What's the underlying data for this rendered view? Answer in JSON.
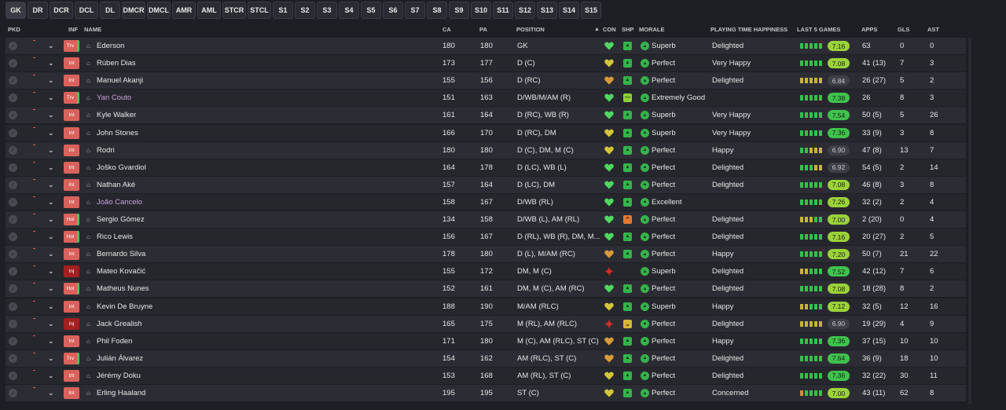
{
  "tabs": [
    "GK",
    "DR",
    "DCR",
    "DCL",
    "DL",
    "DMCR",
    "DMCL",
    "AMR",
    "AML",
    "STCR",
    "STCL",
    "S1",
    "S2",
    "S3",
    "S4",
    "S5",
    "S6",
    "S7",
    "S8",
    "S9",
    "S10",
    "S11",
    "S12",
    "S13",
    "S14",
    "S15"
  ],
  "columns": {
    "pkd": "PKD",
    "inf": "INF",
    "name": "NAME",
    "ca": "CA",
    "pa": "PA",
    "position": "POSITION",
    "con": "CON",
    "shp": "SHP",
    "morale": "MORALE",
    "happiness": "PLAYING TIME HAPPINESS",
    "last5": "LAST 5 GAMES",
    "apps": "APPS",
    "gls": "GLS",
    "ast": "AST"
  },
  "colors": {
    "green": "#35c24a",
    "yellow": "#d6c73a",
    "orange": "#e08a30",
    "red": "#d84a3a",
    "bar_green": "#35c24a",
    "bar_yellow": "#c9b43a",
    "bar_orange": "#d88a35",
    "rating_green": "#3fc24c",
    "rating_lime": "#9bd23a",
    "rating_dim": "#3e4047",
    "con_green": "#4fd85f",
    "con_yellow": "#d4c63a",
    "con_orange": "#d99a3a"
  },
  "players": [
    {
      "inf": "Trv",
      "name": "Ederson",
      "loan": false,
      "ca": "180",
      "pa": "180",
      "position": "GK",
      "con": "green",
      "shp": "green",
      "morale": "Superb",
      "happiness": "Delighted",
      "bars": [
        "g",
        "g",
        "g",
        "g",
        "g"
      ],
      "rating": "7.16",
      "rating_style": "green",
      "apps": "63",
      "gls": "0",
      "ast": "0"
    },
    {
      "inf": "Int",
      "name": "Rúben Dias",
      "loan": false,
      "ca": "173",
      "pa": "177",
      "position": "D (C)",
      "con": "yellow",
      "shp": "green",
      "morale": "Perfect",
      "happiness": "Very Happy",
      "bars": [
        "g",
        "g",
        "g",
        "g",
        "g"
      ],
      "rating": "7.08",
      "rating_style": "green",
      "apps": "41 (13)",
      "gls": "7",
      "ast": "3"
    },
    {
      "inf": "Int",
      "name": "Manuel Akanji",
      "loan": false,
      "ca": "155",
      "pa": "156",
      "position": "D (RC)",
      "con": "orange",
      "shp": "green",
      "morale": "Perfect",
      "happiness": "Delighted",
      "bars": [
        "y",
        "y",
        "y",
        "y",
        "y"
      ],
      "rating": "6.84",
      "rating_style": "dim",
      "apps": "26 (27)",
      "gls": "5",
      "ast": "2"
    },
    {
      "inf": "Trv",
      "name": "Yan Couto",
      "loan": true,
      "ca": "151",
      "pa": "163",
      "position": "D/WB/M/AM (R)",
      "con": "green",
      "shp": "lime",
      "morale": "Extremely Good",
      "happiness": "",
      "bars": [
        "g",
        "g",
        "g",
        "g",
        "g"
      ],
      "rating": "7.38",
      "rating_style": "green",
      "apps": "26",
      "gls": "8",
      "ast": "3"
    },
    {
      "inf": "Int",
      "name": "Kyle Walker",
      "loan": false,
      "ca": "161",
      "pa": "164",
      "position": "D (RC), WB (R)",
      "con": "green",
      "shp": "green",
      "morale": "Superb",
      "happiness": "Very Happy",
      "bars": [
        "g",
        "g",
        "g",
        "g",
        "g"
      ],
      "rating": "7.54",
      "rating_style": "green",
      "apps": "50 (5)",
      "gls": "5",
      "ast": "26"
    },
    {
      "inf": "Int",
      "name": "John Stones",
      "loan": false,
      "ca": "166",
      "pa": "170",
      "position": "D (RC), DM",
      "con": "yellow",
      "shp": "green",
      "morale": "Superb",
      "happiness": "Very Happy",
      "bars": [
        "g",
        "g",
        "g",
        "g",
        "g"
      ],
      "rating": "7.36",
      "rating_style": "green",
      "apps": "33 (9)",
      "gls": "3",
      "ast": "8"
    },
    {
      "inf": "Int",
      "name": "Rodri",
      "loan": false,
      "ca": "180",
      "pa": "180",
      "position": "D (C), DM, M (C)",
      "con": "yellow",
      "shp": "green",
      "morale": "Perfect",
      "happiness": "Happy",
      "bars": [
        "g",
        "g",
        "y",
        "y",
        "y"
      ],
      "rating": "6.90",
      "rating_style": "dim",
      "apps": "47 (8)",
      "gls": "13",
      "ast": "7"
    },
    {
      "inf": "Int",
      "name": "Joško Gvardiol",
      "loan": false,
      "ca": "164",
      "pa": "178",
      "position": "D (LC), WB (L)",
      "con": "green",
      "shp": "green",
      "morale": "Perfect",
      "happiness": "Delighted",
      "bars": [
        "g",
        "g",
        "g",
        "y",
        "y"
      ],
      "rating": "6.92",
      "rating_style": "dim",
      "apps": "54 (5)",
      "gls": "2",
      "ast": "14"
    },
    {
      "inf": "Int",
      "name": "Nathan Aké",
      "loan": false,
      "ca": "157",
      "pa": "164",
      "position": "D (LC), DM",
      "con": "green",
      "shp": "green",
      "morale": "Perfect",
      "happiness": "Delighted",
      "bars": [
        "g",
        "g",
        "g",
        "g",
        "g"
      ],
      "rating": "7.08",
      "rating_style": "green",
      "apps": "46 (8)",
      "gls": "3",
      "ast": "8"
    },
    {
      "inf": "Int",
      "name": "João Cancelo",
      "loan": true,
      "ca": "158",
      "pa": "167",
      "position": "D/WB (RL)",
      "con": "green",
      "shp": "green",
      "morale": "Excellent",
      "happiness": "",
      "bars": [
        "g",
        "g",
        "g",
        "g",
        "g"
      ],
      "rating": "7.26",
      "rating_style": "green",
      "apps": "32 (2)",
      "gls": "2",
      "ast": "4"
    },
    {
      "inf": "Hol",
      "name": "Sergio Gómez",
      "loan": false,
      "ca": "134",
      "pa": "158",
      "position": "D/WB (L), AM (RL)",
      "con": "green",
      "shp": "orange",
      "morale": "Perfect",
      "happiness": "Delighted",
      "bars": [
        "y",
        "y",
        "y",
        "g",
        "g"
      ],
      "rating": "7.00",
      "rating_style": "green",
      "apps": "2 (20)",
      "gls": "0",
      "ast": "4"
    },
    {
      "inf": "Hol",
      "name": "Rico Lewis",
      "loan": false,
      "ca": "156",
      "pa": "167",
      "position": "D (RL), WB (R), DM, M...",
      "con": "green",
      "shp": "green",
      "morale": "Perfect",
      "happiness": "Delighted",
      "bars": [
        "g",
        "g",
        "g",
        "g",
        "g"
      ],
      "rating": "7.16",
      "rating_style": "green",
      "apps": "20 (27)",
      "gls": "2",
      "ast": "5"
    },
    {
      "inf": "Int",
      "name": "Bernardo Silva",
      "loan": false,
      "ca": "178",
      "pa": "180",
      "position": "D (L), M/AM (RC)",
      "con": "orange",
      "shp": "green",
      "morale": "Perfect",
      "happiness": "Happy",
      "bars": [
        "g",
        "g",
        "g",
        "g",
        "g"
      ],
      "rating": "7.20",
      "rating_style": "green",
      "apps": "50 (7)",
      "gls": "21",
      "ast": "22"
    },
    {
      "inf": "Inj",
      "name": "Mateo Kovačić",
      "loan": false,
      "ca": "155",
      "pa": "172",
      "position": "DM, M (C)",
      "con": "injury",
      "shp": "none",
      "morale": "Superb",
      "happiness": "Delighted",
      "bars": [
        "y",
        "y",
        "g",
        "g",
        "g"
      ],
      "rating": "7.52",
      "rating_style": "green",
      "apps": "42 (12)",
      "gls": "7",
      "ast": "6"
    },
    {
      "inf": "Hol",
      "name": "Matheus Nunes",
      "loan": false,
      "ca": "152",
      "pa": "161",
      "position": "DM, M (C), AM (RC)",
      "con": "green",
      "shp": "green",
      "morale": "Perfect",
      "happiness": "Delighted",
      "bars": [
        "g",
        "g",
        "g",
        "g",
        "g"
      ],
      "rating": "7.08",
      "rating_style": "green",
      "apps": "18 (28)",
      "gls": "8",
      "ast": "2"
    },
    {
      "inf": "Int",
      "name": "Kevin De Bruyne",
      "loan": false,
      "ca": "188",
      "pa": "190",
      "position": "M/AM (RLC)",
      "con": "yellow",
      "shp": "green",
      "morale": "Superb",
      "happiness": "Happy",
      "bars": [
        "y",
        "y",
        "g",
        "g",
        "g"
      ],
      "rating": "7.12",
      "rating_style": "green",
      "apps": "32 (5)",
      "gls": "12",
      "ast": "16"
    },
    {
      "inf": "Inj",
      "name": "Jack Grealish",
      "loan": false,
      "ca": "165",
      "pa": "175",
      "position": "M (RL), AM (RLC)",
      "con": "injury",
      "shp": "yellow",
      "morale": "Perfect",
      "happiness": "Delighted",
      "bars": [
        "y",
        "y",
        "y",
        "y",
        "y"
      ],
      "rating": "6.90",
      "rating_style": "dim",
      "apps": "19 (29)",
      "gls": "4",
      "ast": "9"
    },
    {
      "inf": "Int",
      "name": "Phil Foden",
      "loan": false,
      "ca": "171",
      "pa": "180",
      "position": "M (C), AM (RLC), ST (C)",
      "con": "orange",
      "shp": "green",
      "morale": "Perfect",
      "happiness": "Happy",
      "bars": [
        "g",
        "g",
        "g",
        "g",
        "g"
      ],
      "rating": "7.36",
      "rating_style": "green",
      "apps": "37 (15)",
      "gls": "10",
      "ast": "10"
    },
    {
      "inf": "Trv",
      "name": "Julián Álvarez",
      "loan": false,
      "ca": "154",
      "pa": "162",
      "position": "AM (RLC), ST (C)",
      "con": "orange",
      "shp": "green",
      "morale": "Perfect",
      "happiness": "Delighted",
      "bars": [
        "g",
        "g",
        "g",
        "g",
        "g"
      ],
      "rating": "7.64",
      "rating_style": "green",
      "apps": "36 (9)",
      "gls": "18",
      "ast": "10"
    },
    {
      "inf": "Int",
      "name": "Jérémy Doku",
      "loan": false,
      "ca": "153",
      "pa": "168",
      "position": "AM (RL), ST (C)",
      "con": "yellow",
      "shp": "green",
      "morale": "Perfect",
      "happiness": "Delighted",
      "bars": [
        "g",
        "g",
        "g",
        "g",
        "g"
      ],
      "rating": "7.36",
      "rating_style": "green",
      "apps": "32 (22)",
      "gls": "30",
      "ast": "11"
    },
    {
      "inf": "Int",
      "name": "Erling Haaland",
      "loan": false,
      "ca": "195",
      "pa": "195",
      "position": "ST (C)",
      "con": "yellow",
      "shp": "green",
      "morale": "Perfect",
      "happiness": "Concerned",
      "bars": [
        "o",
        "g",
        "g",
        "g",
        "g"
      ],
      "rating": "7.00",
      "rating_style": "green",
      "apps": "43 (11)",
      "gls": "62",
      "ast": "8"
    }
  ]
}
